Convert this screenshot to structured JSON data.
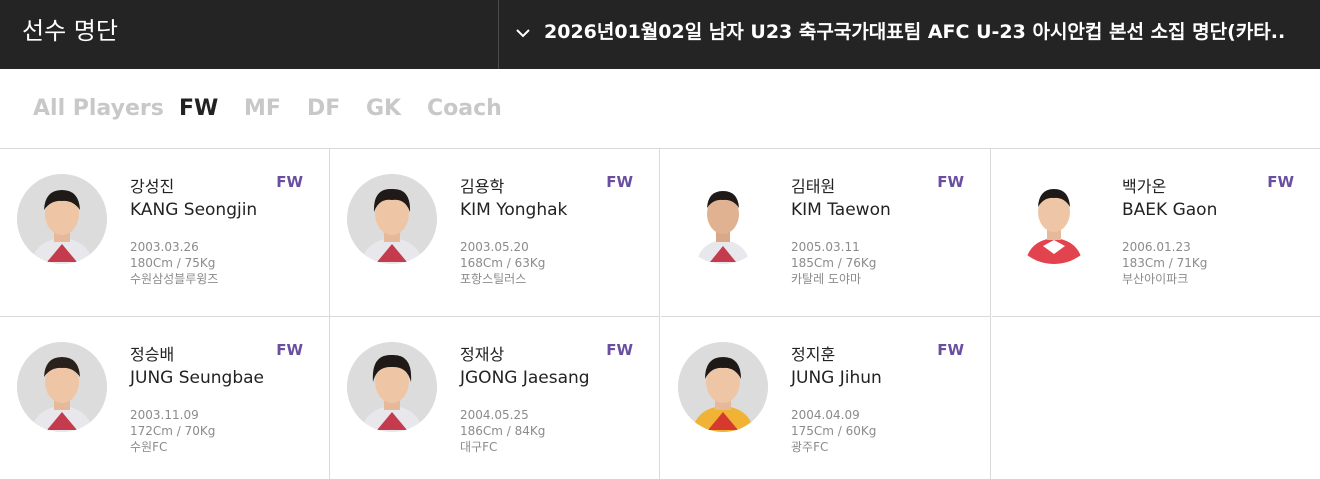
{
  "header": {
    "title": "선수 명단",
    "squad_selector": "2026년01월02일 남자 U23 축구국가대표팀 AFC U-23 아시안컵 본선 소집 명단(카타.."
  },
  "tabs": [
    {
      "label": "All Players",
      "active": false
    },
    {
      "label": "FW",
      "active": true
    },
    {
      "label": "MF",
      "active": false
    },
    {
      "label": "DF",
      "active": false
    },
    {
      "label": "GK",
      "active": false
    },
    {
      "label": "Coach",
      "active": false
    }
  ],
  "players": [
    {
      "name_ko": "강성진",
      "name_en": "KANG Seongjin",
      "position": "FW",
      "birth": "2003.03.26",
      "body": "180Cm / 75Kg",
      "club": "수원삼성블루윙즈"
    },
    {
      "name_ko": "김용학",
      "name_en": "KIM Yonghak",
      "position": "FW",
      "birth": "2003.05.20",
      "body": "168Cm / 63Kg",
      "club": "포항스틸러스"
    },
    {
      "name_ko": "김태원",
      "name_en": "KIM Taewon",
      "position": "FW",
      "birth": "2005.03.11",
      "body": "185Cm / 76Kg",
      "club": "카탈레 도야마"
    },
    {
      "name_ko": "백가온",
      "name_en": "BAEK Gaon",
      "position": "FW",
      "birth": "2006.01.23",
      "body": "183Cm / 71Kg",
      "club": "부산아이파크"
    },
    {
      "name_ko": "정승배",
      "name_en": "JUNG Seungbae",
      "position": "FW",
      "birth": "2003.11.09",
      "body": "172Cm / 70Kg",
      "club": "수원FC"
    },
    {
      "name_ko": "정재상",
      "name_en": "JGONG Jaesang",
      "position": "FW",
      "birth": "2004.05.25",
      "body": "186Cm / 84Kg",
      "club": "대구FC"
    },
    {
      "name_ko": "정지훈",
      "name_en": "JUNG Jihun",
      "position": "FW",
      "birth": "2004.04.09",
      "body": "175Cm / 60Kg",
      "club": "광주FC"
    }
  ],
  "colors": {
    "topbar_bg": "#242424",
    "position_accent": "#6a4ea0",
    "tab_inactive": "#c8c8c8",
    "tab_active": "#222222"
  }
}
